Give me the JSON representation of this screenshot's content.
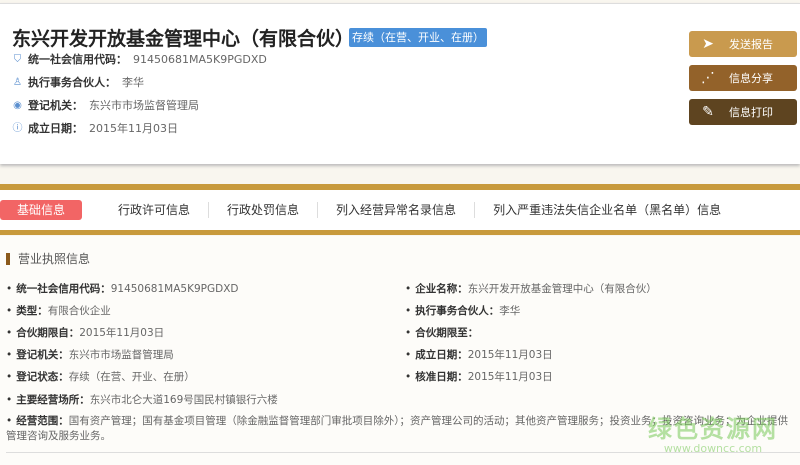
{
  "header": {
    "title": "东兴开发开放基金管理中心（有限合伙）",
    "status_badge": "存续（在营、开业、在册）",
    "meta": [
      {
        "icon": "shield-icon",
        "label": "统一社会信用代码：",
        "value": "91450681MA5K9PGDXD"
      },
      {
        "icon": "person-icon",
        "label": "执行事务合伙人：",
        "value": "李华"
      },
      {
        "icon": "location-icon",
        "label": "登记机关：",
        "value": "东兴市市场监督管理局"
      },
      {
        "icon": "info-icon",
        "label": "成立日期：",
        "value": "2015年11月03日"
      }
    ]
  },
  "actions": [
    {
      "label": "发送报告",
      "icon": "send-icon",
      "color": "#c99a4e"
    },
    {
      "label": "信息分享",
      "icon": "share-icon",
      "color": "#93622a"
    },
    {
      "label": "信息打印",
      "icon": "pencil-icon",
      "color": "#5e4420"
    }
  ],
  "tabs": [
    "基础信息",
    "行政许可信息",
    "行政处罚信息",
    "列入经营异常名录信息",
    "列入严重违法失信企业名单（黑名单）信息"
  ],
  "section_title": "营业执照信息",
  "fields_left": [
    {
      "label": "统一社会信用代码：",
      "value": "91450681MA5K9PGDXD"
    },
    {
      "label": "类型：",
      "value": "有限合伙企业"
    },
    {
      "label": "合伙期限自：",
      "value": "2015年11月03日"
    },
    {
      "label": "登记机关：",
      "value": "东兴市市场监督管理局"
    },
    {
      "label": "登记状态：",
      "value": "存续（在营、开业、在册）"
    }
  ],
  "fields_right": [
    {
      "label": "企业名称：",
      "value": "东兴开发开放基金管理中心（有限合伙）"
    },
    {
      "label": "执行事务合伙人：",
      "value": "李华"
    },
    {
      "label": "合伙期限至：",
      "value": ""
    },
    {
      "label": "成立日期：",
      "value": "2015年11月03日"
    },
    {
      "label": "核准日期：",
      "value": "2015年11月03日"
    }
  ],
  "address": {
    "label": "主要经营场所：",
    "value": "东兴市北仑大道169号国民村镇银行六楼"
  },
  "scope": {
    "label": "经营范围：",
    "value": "国有资产管理；国有基金项目管理（除金融监督管理部门审批项目除外）；资产管理公司的活动；其他资产管理服务；投资业务；投资咨询业务；为企业提供管理咨询及服务业务。"
  },
  "watermark": {
    "name": "绿色资源网",
    "url": "www.downcc.com"
  }
}
